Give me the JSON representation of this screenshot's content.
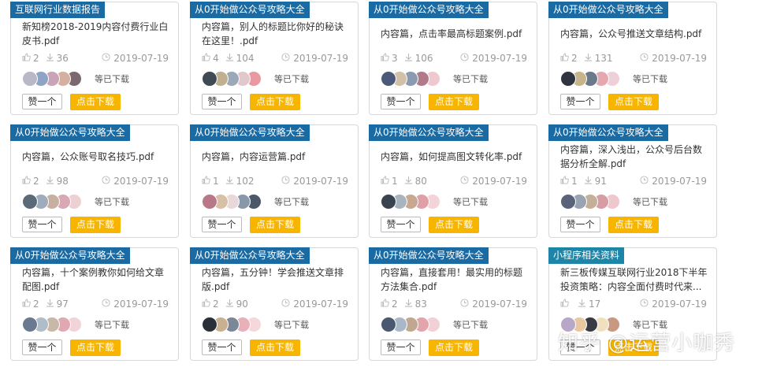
{
  "colors": {
    "tag_blue": "#1a6aa3",
    "tag_teal": "#1d85a8",
    "download_button": "#f7b500"
  },
  "cards": [
    {
      "tag": "互联网行业数据报告",
      "tag_color": "#1a6aa3",
      "title": "新知榜2018-2019内容付费行业白皮书.pdf",
      "likes": "2",
      "downloads": "36",
      "date": "2019-07-19",
      "download_text": "等已下载",
      "like_label": "赞一个",
      "download_label": "点击下载",
      "avatar_colors": [
        "#b8b8c8",
        "#8ea4c4",
        "#c9a3b6",
        "#d5b0a0",
        "#7a6a70"
      ]
    },
    {
      "tag": "从0开始做公众号攻略大全",
      "tag_color": "#1a6aa3",
      "title": "内容篇，别人的标题比你好的秘诀在这里！.pdf",
      "likes": "4",
      "downloads": "104",
      "date": "2019-07-19",
      "download_text": "等已下载",
      "like_label": "赞一个",
      "download_label": "点击下载",
      "avatar_colors": [
        "#3f4a55",
        "#c0b090",
        "#9aa8b8",
        "#e0c8cc",
        "#e89aa0"
      ]
    },
    {
      "tag": "从0开始做公众号攻略大全",
      "tag_color": "#1a6aa3",
      "title": "内容篇，点击率最高标题案例.pdf",
      "likes": "3",
      "downloads": "106",
      "date": "2019-07-19",
      "download_text": "等已下载",
      "like_label": "赞一个",
      "download_label": "点击下载",
      "avatar_colors": [
        "#4a5a78",
        "#d2c0a8",
        "#8a9ab0",
        "#b07a88",
        "#f0c8d0"
      ]
    },
    {
      "tag": "从0开始做公众号攻略大全",
      "tag_color": "#1a6aa3",
      "title": "内容篇，公众号推送文章结构.pdf",
      "likes": "2",
      "downloads": "131",
      "date": "2019-07-19",
      "download_text": "等已下载",
      "like_label": "赞一个",
      "download_label": "点击下载",
      "avatar_colors": [
        "#2e3440",
        "#c8b48a",
        "#6a7a8a",
        "#e6a8b0",
        "#f0d0d8"
      ]
    },
    {
      "tag": "从0开始做公众号攻略大全",
      "tag_color": "#1a6aa3",
      "title": "内容篇，公众账号取名技巧.pdf",
      "likes": "2",
      "downloads": "98",
      "date": "2019-07-19",
      "download_text": "等已下载",
      "like_label": "赞一个",
      "download_label": "点击下载",
      "avatar_colors": [
        "#5a6a78",
        "#a0acbc",
        "#c8b0a0",
        "#d8a8b4",
        "#ecd0d4"
      ]
    },
    {
      "tag": "从0开始做公众号攻略大全",
      "tag_color": "#1a6aa3",
      "title": "内容篇，内容运营篇.pdf",
      "likes": "1",
      "downloads": "102",
      "date": "2019-07-19",
      "download_text": "等已下载",
      "like_label": "赞一个",
      "download_label": "点击下载",
      "avatar_colors": [
        "#b87888",
        "#d8c0a8",
        "#e8d8dc",
        "#8898a8",
        "#4a5868"
      ]
    },
    {
      "tag": "从0开始做公众号攻略大全",
      "tag_color": "#1a6aa3",
      "title": "内容篇，如何提高图文转化率.pdf",
      "likes": "1",
      "downloads": "80",
      "date": "2019-07-19",
      "download_text": "等已下载",
      "like_label": "赞一个",
      "download_label": "点击下载",
      "avatar_colors": [
        "#3a4450",
        "#a8b4c0",
        "#c8a890",
        "#e0a0a8",
        "#f4d4d8"
      ]
    },
    {
      "tag": "从0开始做公众号攻略大全",
      "tag_color": "#1a6aa3",
      "title": "内容篇，深入浅出，公众号后台数据分析全解.pdf",
      "likes": "1",
      "downloads": "91",
      "date": "2019-07-19",
      "download_text": "等已下载",
      "like_label": "赞一个",
      "download_label": "点击下载",
      "avatar_colors": [
        "#5a6478",
        "#98a4b4",
        "#c4b098",
        "#d89ca4",
        "#eec8ce"
      ]
    },
    {
      "tag": "从0开始做公众号攻略大全",
      "tag_color": "#1a6aa3",
      "title": "内容篇，十个案例教你如何给文章配图.pdf",
      "likes": "2",
      "downloads": "97",
      "date": "2019-07-19",
      "download_text": "等已下载",
      "like_label": "赞一个",
      "download_label": "点击下载",
      "avatar_colors": [
        "#6a7890",
        "#b0bcc8",
        "#c8b8a8",
        "#e0a8b0",
        "#f0d4d8"
      ]
    },
    {
      "tag": "从0开始做公众号攻略大全",
      "tag_color": "#1a6aa3",
      "title": "内容篇，五分钟！学会推送文章排版.pdf",
      "likes": "2",
      "downloads": "90",
      "date": "2019-07-19",
      "download_text": "等已下载",
      "like_label": "赞一个",
      "download_label": "点击下载",
      "avatar_colors": [
        "#2a3038",
        "#c8b090",
        "#7a8898",
        "#e8b0b8",
        "#f4d8dc"
      ]
    },
    {
      "tag": "从0开始做公众号攻略大全",
      "tag_color": "#1a6aa3",
      "title": "内容篇，直接套用！最实用的标题方法集合.pdf",
      "likes": "2",
      "downloads": "83",
      "date": "2019-07-19",
      "download_text": "等已下载",
      "like_label": "赞一个",
      "download_label": "点击下载",
      "avatar_colors": [
        "#4a5870",
        "#a8b8c8",
        "#c0a890",
        "#e4a4ac",
        "#f2d0d6"
      ]
    },
    {
      "tag": "小程序相关资料",
      "tag_color": "#1d85a8",
      "title": "新三板传媒互联网行业2018下半年投资策略：内容全面付费时代来...",
      "likes": "",
      "downloads": "17",
      "date": "2019-07-19",
      "download_text": "等已下载",
      "like_label": "赞一个",
      "download_label": "点击下载",
      "avatar_colors": [
        "#b8a8c8",
        "#e8c8a0",
        "#3a3a44",
        "#f0e0c0",
        "#c89880"
      ]
    }
  ],
  "watermark": "知乎 @运营小咖秀"
}
